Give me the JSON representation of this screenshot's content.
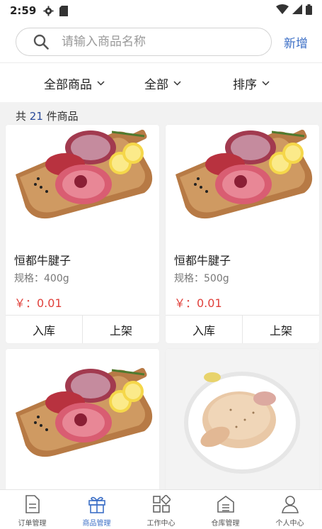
{
  "status_bar": {
    "time": "2:59"
  },
  "search": {
    "placeholder": "请输入商品名称",
    "value": "",
    "add_label": "新增"
  },
  "filters": [
    {
      "label": "全部商品"
    },
    {
      "label": "全部"
    },
    {
      "label": "排序"
    }
  ],
  "summary": {
    "prefix": "共",
    "count": "21",
    "suffix": "件商品"
  },
  "products": [
    {
      "name": "恒都牛腱子",
      "spec": "规格：400g",
      "price": "￥：0.01",
      "action_in": "入库",
      "action_shelf": "上架",
      "image": "beef-image"
    },
    {
      "name": "恒都牛腱子",
      "spec": "规格：500g",
      "price": "￥：0.01",
      "action_in": "入库",
      "action_shelf": "上架",
      "image": "beef-image"
    },
    {
      "image": "beef-image"
    },
    {
      "image": "chicken-image"
    }
  ],
  "bottom_nav": [
    {
      "label": "订单管理",
      "icon": "order-icon"
    },
    {
      "label": "商品管理",
      "icon": "gift-icon",
      "active": true
    },
    {
      "label": "工作中心",
      "icon": "grid-icon"
    },
    {
      "label": "仓库管理",
      "icon": "warehouse-icon"
    },
    {
      "label": "个人中心",
      "icon": "user-icon"
    }
  ],
  "colors": {
    "accent": "#3c6fc6",
    "price": "#e0413c",
    "count": "#2a4a9a"
  }
}
